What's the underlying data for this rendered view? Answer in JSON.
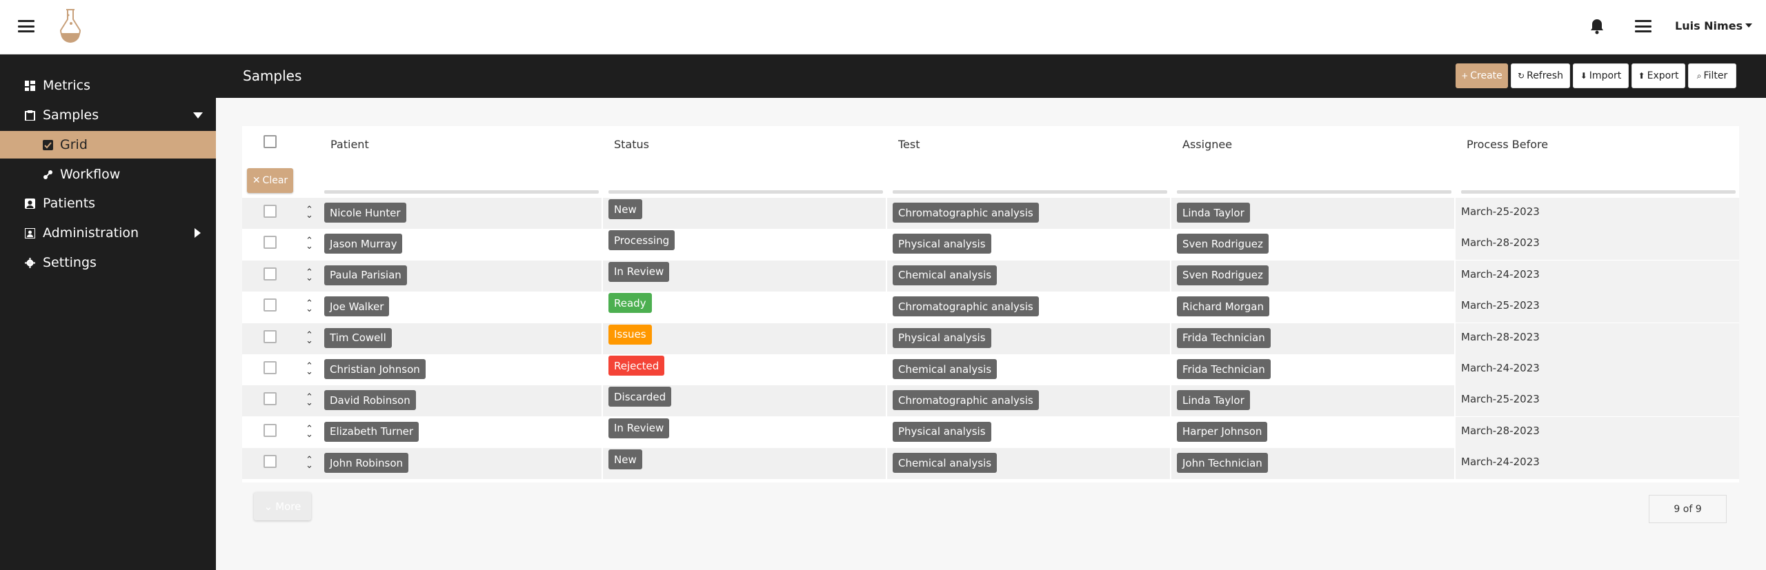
{
  "topbar": {
    "user_name": "Luis Nimes"
  },
  "sidebar": {
    "items": [
      {
        "label": "Metrics",
        "icon": "dashboard-icon"
      },
      {
        "label": "Samples",
        "icon": "clipboard-icon"
      },
      {
        "label": "Grid",
        "icon": "checkbox-icon"
      },
      {
        "label": "Workflow",
        "icon": "workflow-icon"
      },
      {
        "label": "Patients",
        "icon": "patient-icon"
      },
      {
        "label": "Administration",
        "icon": "admin-icon"
      },
      {
        "label": "Settings",
        "icon": "gear-icon"
      }
    ]
  },
  "header": {
    "title": "Samples",
    "buttons": {
      "create": "Create",
      "refresh": "Refresh",
      "import": "Import",
      "export": "Export",
      "filter": "Filter"
    }
  },
  "grid": {
    "columns": [
      "Patient",
      "Status",
      "Test",
      "Assignee",
      "Process Before"
    ],
    "clear_label": "Clear",
    "more_label": "More",
    "pager": "9 of 9",
    "rows": [
      {
        "patient": "Nicole Hunter",
        "status": "New",
        "test": "Chromatographic analysis",
        "assignee": "Linda Taylor",
        "date": "March-25-2023"
      },
      {
        "patient": "Jason Murray",
        "status": "Processing",
        "test": "Physical analysis",
        "assignee": "Sven Rodriguez",
        "date": "March-28-2023"
      },
      {
        "patient": "Paula Parisian",
        "status": "In Review",
        "test": "Chemical analysis",
        "assignee": "Sven Rodriguez",
        "date": "March-24-2023"
      },
      {
        "patient": "Joe Walker",
        "status": "Ready",
        "test": "Chromatographic analysis",
        "assignee": "Richard Morgan",
        "date": "March-25-2023"
      },
      {
        "patient": "Tim Cowell",
        "status": "Issues",
        "test": "Physical analysis",
        "assignee": "Frida Technician",
        "date": "March-28-2023"
      },
      {
        "patient": "Christian Johnson",
        "status": "Rejected",
        "test": "Chemical analysis",
        "assignee": "Frida Technician",
        "date": "March-24-2023"
      },
      {
        "patient": "David Robinson",
        "status": "Discarded",
        "test": "Chromatographic analysis",
        "assignee": "Linda Taylor",
        "date": "March-25-2023"
      },
      {
        "patient": "Elizabeth Turner",
        "status": "In Review",
        "test": "Physical analysis",
        "assignee": "Harper Johnson",
        "date": "March-28-2023"
      },
      {
        "patient": "John Robinson",
        "status": "New",
        "test": "Chemical analysis",
        "assignee": "John Technician",
        "date": "March-24-2023"
      }
    ]
  },
  "colors": {
    "accent": "#d1a880",
    "dark": "#1e1e1e",
    "pill_default": "#666666",
    "status_ready": "#4caf50",
    "status_issues": "#ff9800",
    "status_rejected": "#f44336"
  }
}
